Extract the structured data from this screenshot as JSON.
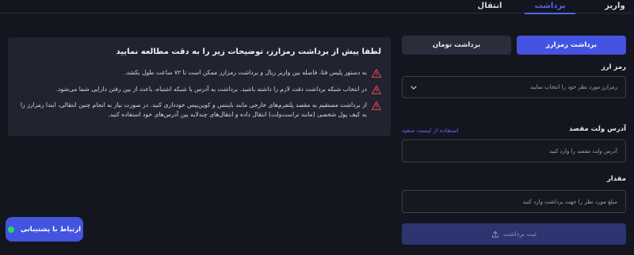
{
  "top_tabs": [
    {
      "label": "واریز"
    },
    {
      "label": "برداشت"
    },
    {
      "label": "انتقال"
    }
  ],
  "withdraw_tabs": [
    {
      "label": "برداشت رمزارز"
    },
    {
      "label": "برداشت تومان"
    }
  ],
  "info": {
    "title": "لطفا پیش از برداشت رمزارز، توضیحات زیر را به دقت مطالعه نمایید",
    "items": [
      "به دستور پلیس فتا، فاصله بین واریز ریال و برداشت رمزارز ممکن است تا ۷۲ ساعت طول بکشد.",
      "در انتخاب شبکه برداشت دقت لازم را داشته باشید. برداشت به آدرس یا شبکه اشتباه، باعث از بین رفتن دارایی شما می‌شود.",
      "از برداشت مستقیم به مقصد پلتفرم‌های خارجی مانند بایننس و کوین‌بیس خودداری کنید. در صورت نیاز به انجام چنین انتقالی، ابتدا رمزارز را به کیف پول شخصی (مانند تراست‌ولت) انتقال داده و انتقال‌های چندلایه بین آدرس‌های خود استفاده کنید."
    ]
  },
  "form": {
    "currency_label": "رمز ارز",
    "currency_placeholder": "رمزارز مورد نظر خود را انتخاب نمایید",
    "address_label": "آدرس ولت مقصد",
    "address_link": "استفاده از لیست سفید",
    "address_placeholder": "آدرس ولت مقصد را وارد کنید",
    "amount_label": "مقدار",
    "amount_placeholder": "مبلغ مورد نظر را جهت برداشت وارد کنید",
    "submit_label": "ثبت برداشت"
  },
  "support": {
    "label": "ارتباط با پشتیبانی"
  },
  "colors": {
    "background": "#14161f",
    "panel": "#21232f",
    "accent": "#4254e0",
    "warning": "#e0454f",
    "online": "#22dd55"
  },
  "icons": {
    "warning": "warning-triangle-icon",
    "chevron": "chevron-down-icon",
    "submit": "upload-arrow-icon"
  }
}
